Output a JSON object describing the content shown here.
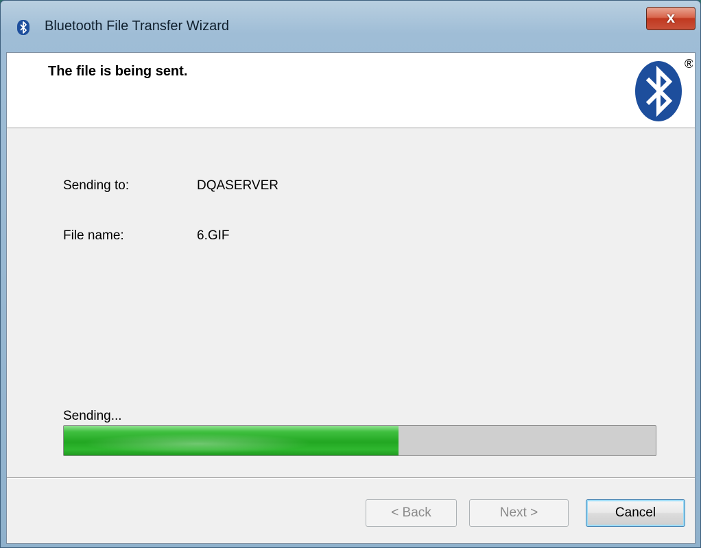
{
  "window": {
    "title": "Bluetooth File Transfer Wizard",
    "close_label": "x"
  },
  "header": {
    "heading": "The file is being sent.",
    "logo": "bluetooth-logo",
    "registered_mark": "®"
  },
  "details": {
    "sending_to_label": "Sending to:",
    "sending_to_value": "DQASERVER",
    "file_name_label": "File name:",
    "file_name_value": "6.GIF"
  },
  "progress": {
    "status": "Sending...",
    "fraction": 0.565,
    "color": "#2db52d"
  },
  "buttons": {
    "back": "< Back",
    "next": "Next >",
    "cancel": "Cancel"
  },
  "colors": {
    "bluetooth_blue": "#1d4e9c"
  }
}
